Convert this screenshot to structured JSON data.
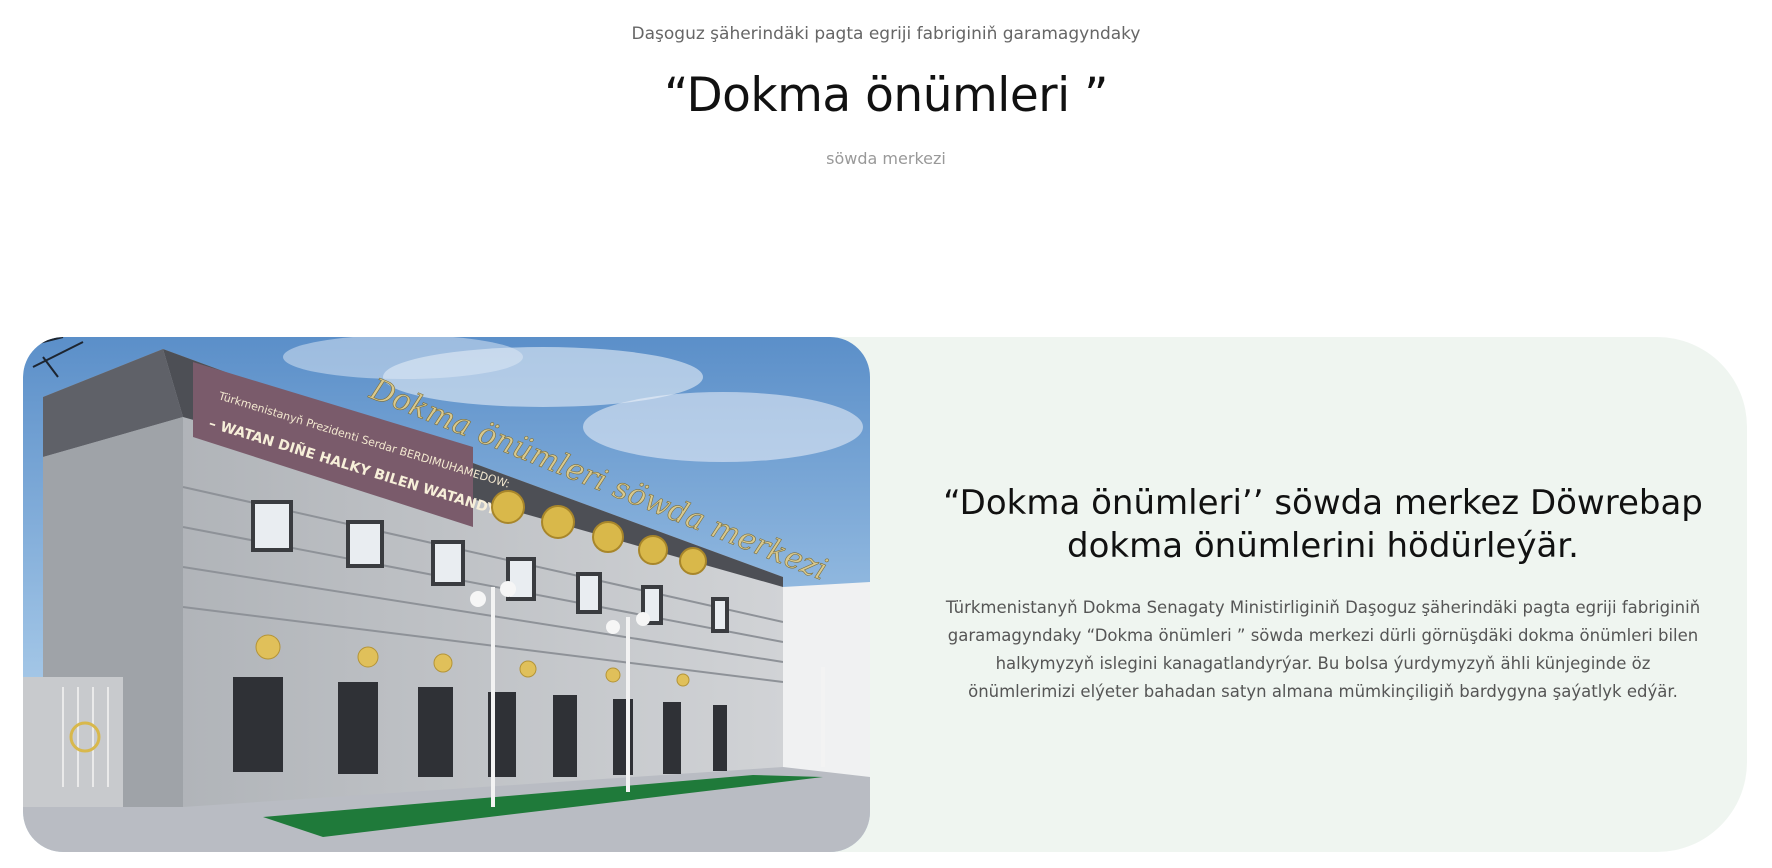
{
  "hero": {
    "subtitle": "Daşoguz şäherindäki pagta egriji fabriginiň garamagyndaky",
    "title": "“Dokma önümleri ”",
    "caption": "söwda merkezi"
  },
  "about": {
    "heading": "“Dokma önümleri’’ söwda merkez Döwrebap dokma önümlerini hödürleýär.",
    "body": "Türkmenistanyň Dokma Senagaty Ministirliginiň Daşoguz şäherindäki pagta egriji fabriginiň garamagyndaky “Dokma önümleri ” söwda merkezi dürli görnüşdäki dokma önümleri bilen halkymyzyň islegini kanagatlandyrýar. Bu bolsa ýurdymyzyň ähli künjeginde öz önümlerimizi elýeter bahadan satyn almana mümkinçiligiň bardygyna şaýatlyk edýär.",
    "photo": {
      "sign_script": "Dokma önümleri söwda merkezi",
      "banner_line1": "Türkmenistanyň Prezidenti Serdar BERDIMUHAMEDOW:",
      "banner_line2": "– WATAN DIÑE HALKY BILEN WATANDYR!"
    }
  },
  "colors": {
    "card_bg": "#eff5f0",
    "heading": "#111111",
    "muted": "#666666"
  }
}
